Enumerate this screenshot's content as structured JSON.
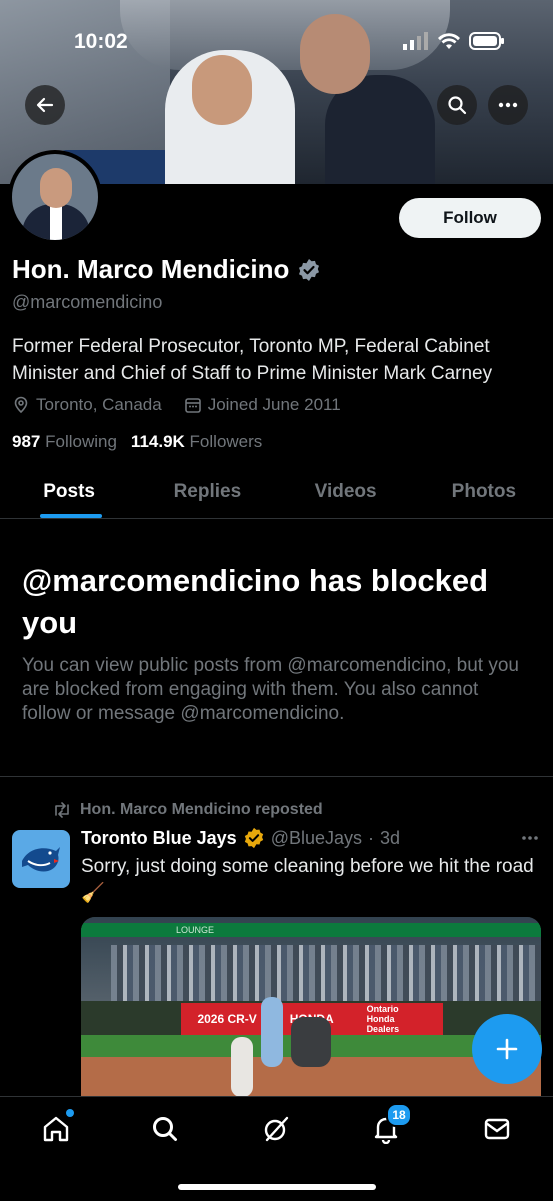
{
  "status_bar": {
    "time": "10:02"
  },
  "profile": {
    "name": "Hon. Marco Mendicino",
    "handle": "@marcomendicino",
    "bio": "Former Federal Prosecutor, Toronto MP, Federal Cabinet Minister and Chief of Staff to Prime Minister Mark Carney",
    "location": "Toronto, Canada",
    "joined": "Joined June 2011",
    "following_count": "987",
    "following_label": "Following",
    "followers_count": "114.9K",
    "followers_label": "Followers",
    "follow_button": "Follow",
    "verified_color": "#1d9bf0"
  },
  "tabs": [
    {
      "label": "Posts",
      "active": true
    },
    {
      "label": "Replies",
      "active": false
    },
    {
      "label": "Videos",
      "active": false
    },
    {
      "label": "Photos",
      "active": false
    }
  ],
  "blocked": {
    "title": "@marcomendicino has blocked you",
    "description": "You can view public posts from @marcomendicino, but you are blocked from engaging with them. You also cannot follow or message @marcomendicino."
  },
  "post": {
    "repost_label": "Hon. Marco Mendicino reposted",
    "author_name": "Toronto Blue Jays",
    "author_handle": "@BlueJays",
    "separator": "·",
    "time": "3d",
    "text": "Sorry, just doing some cleaning before we hit the road 🧹",
    "media_ad_text_1": "2026 CR-V",
    "media_ad_text_2": "HONDA",
    "media_ad_text_3": "Ontario Honda Dealers",
    "media_ribbon": "LOUNGE",
    "verified_color": "#e8a80c"
  },
  "bottom_nav": {
    "notifications_badge": "18",
    "icons": [
      "home-icon",
      "search-icon",
      "grok-icon",
      "notifications-icon",
      "messages-icon"
    ]
  },
  "colors": {
    "accent": "#1d9bf0",
    "background": "#000000",
    "muted": "#71767b"
  }
}
